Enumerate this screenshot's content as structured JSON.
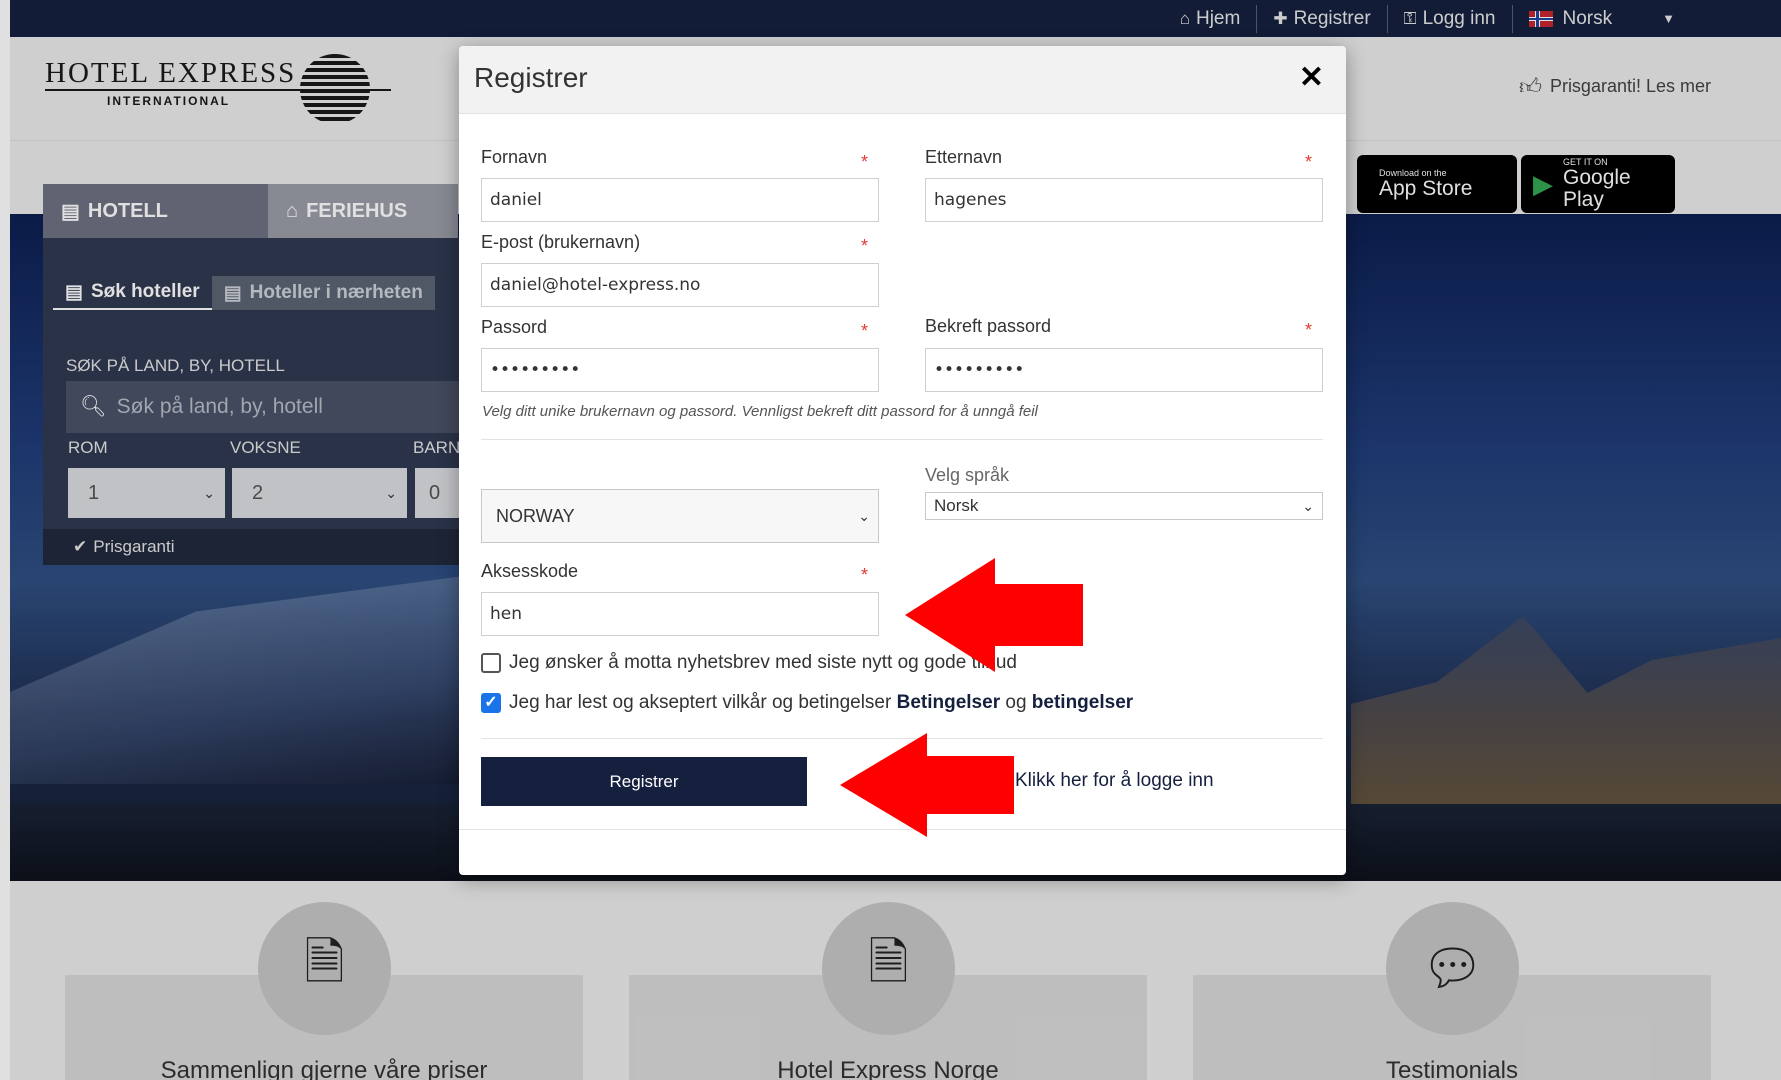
{
  "topnav": {
    "home": "Hjem",
    "register": "Registrer",
    "login": "Logg inn",
    "language": "Norsk"
  },
  "header": {
    "logo_main": "HOTEL EXPRESS",
    "logo_sub": "INTERNATIONAL",
    "price_guarantee": "Prisgaranti! Les mer"
  },
  "app_buttons": {
    "apple_small": "Download on the",
    "apple_big": "App Store",
    "google_small": "GET IT ON",
    "google_big": "Google Play"
  },
  "search": {
    "tabs": [
      "HOTELL",
      "FERIEHUS"
    ],
    "subtabs": [
      "Søk hoteller",
      "Hoteller i nærheten"
    ],
    "label": "SØK PÅ LAND, BY, HOTELL",
    "placeholder": "Søk på land, by, hotell",
    "rooms_label": "ROM",
    "rooms_value": "1",
    "adults_label": "VOKSNE",
    "adults_value": "2",
    "children_label": "BARN",
    "children_value": "0",
    "footer": "Prisgaranti"
  },
  "cards": [
    {
      "title": "Sammenlign gjerne våre priser"
    },
    {
      "title": "Hotel Express Norge"
    },
    {
      "title": "Testimonials"
    }
  ],
  "modal": {
    "title": "Registrer",
    "close": "✕",
    "first_name_label": "Fornavn",
    "first_name_value": "daniel",
    "last_name_label": "Etternavn",
    "last_name_value": "hagenes",
    "email_label": "E-post (brukernavn)",
    "email_value": "daniel@hotel-express.no",
    "password_label": "Passord",
    "password_value": "•••••••••",
    "confirm_password_label": "Bekreft passord",
    "confirm_password_value": "•••••••••",
    "hint": "Velg ditt unike brukernavn og passord. Vennligst bekreft ditt passord for å unngå feil",
    "country_value": "NORWAY",
    "language_label": "Velg språk",
    "language_value": "Norsk",
    "access_code_label": "Aksesskode",
    "access_code_value": "hen",
    "required_mark": "*",
    "newsletter_text": "Jeg ønsker å motta nyhetsbrev med siste nytt og gode tilbud",
    "newsletter_checked": false,
    "terms_text": "Jeg har lest og akseptert vilkår og betingelser",
    "terms_link1": "Betingelser",
    "terms_and": "og",
    "terms_link2": "betingelser",
    "terms_checked": true,
    "submit_label": "Registrer",
    "login_link": "Klikk her for å logge inn"
  },
  "colors": {
    "navy": "#15203f",
    "required": "#e53935",
    "annotation_arrow": "#ff0000"
  }
}
